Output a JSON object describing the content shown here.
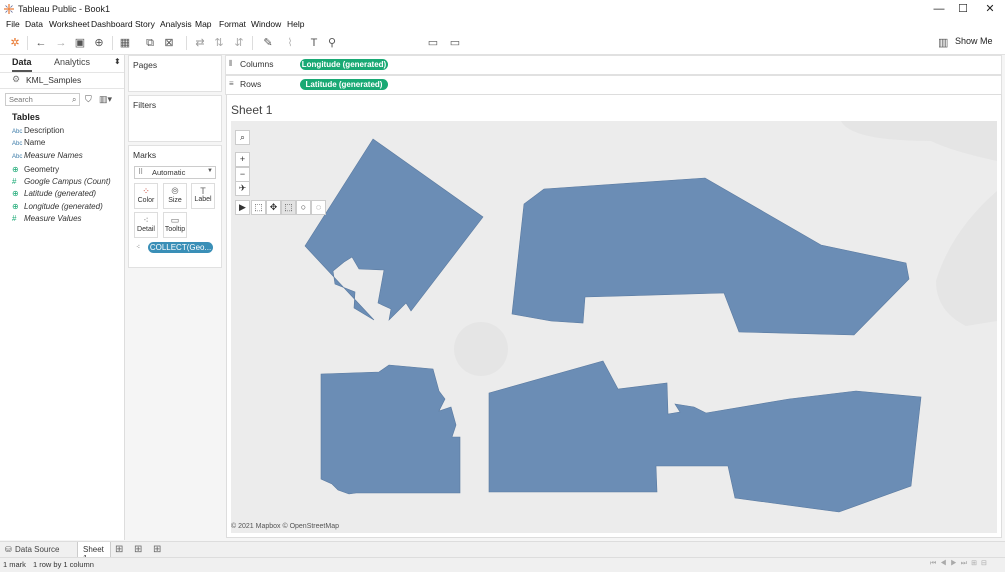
{
  "window": {
    "title": "Tableau Public - Book1"
  },
  "menu": [
    "File",
    "Data",
    "Worksheet",
    "Dashboard",
    "Story",
    "Analysis",
    "Map",
    "Format",
    "Window",
    "Help"
  ],
  "toolbar": {
    "show_me": "Show Me"
  },
  "data_pane": {
    "tabs": [
      "Data",
      "Analytics"
    ],
    "datasource": "KML_Samples",
    "search_placeholder": "Search",
    "tables_heading": "Tables",
    "fields": [
      {
        "icon": "Abc",
        "name": "Description",
        "italic": false
      },
      {
        "icon": "Abc",
        "name": "Name",
        "italic": false
      },
      {
        "icon": "Abc",
        "name": "Measure Names",
        "italic": true
      },
      {
        "icon": "globe",
        "name": "Geometry",
        "italic": false
      },
      {
        "icon": "#",
        "name": "Google Campus (Count)",
        "italic": true
      },
      {
        "icon": "globe",
        "name": "Latitude (generated)",
        "italic": true
      },
      {
        "icon": "globe",
        "name": "Longitude (generated)",
        "italic": true
      },
      {
        "icon": "#",
        "name": "Measure Values",
        "italic": true
      }
    ]
  },
  "cards": {
    "pages": "Pages",
    "filters": "Filters",
    "marks": "Marks",
    "mark_type": "Automatic",
    "mark_buttons": [
      "Color",
      "Size",
      "Label",
      "Detail",
      "Tooltip"
    ],
    "marks_pill": "COLLECT(Geo..."
  },
  "shelves": {
    "columns_label": "Columns",
    "columns_pill": "Longitude (generated)",
    "rows_label": "Rows",
    "rows_pill": "Latitude (generated)"
  },
  "view": {
    "sheet_title": "Sheet 1",
    "copyright": "© 2021 Mapbox © OpenStreetMap",
    "fill_color": "#6b8db5"
  },
  "tabs": {
    "data_source": "Data Source",
    "sheet": "Sheet 1"
  },
  "status": {
    "marks": "1 mark",
    "rows_cols": "1 row by 1 column"
  }
}
